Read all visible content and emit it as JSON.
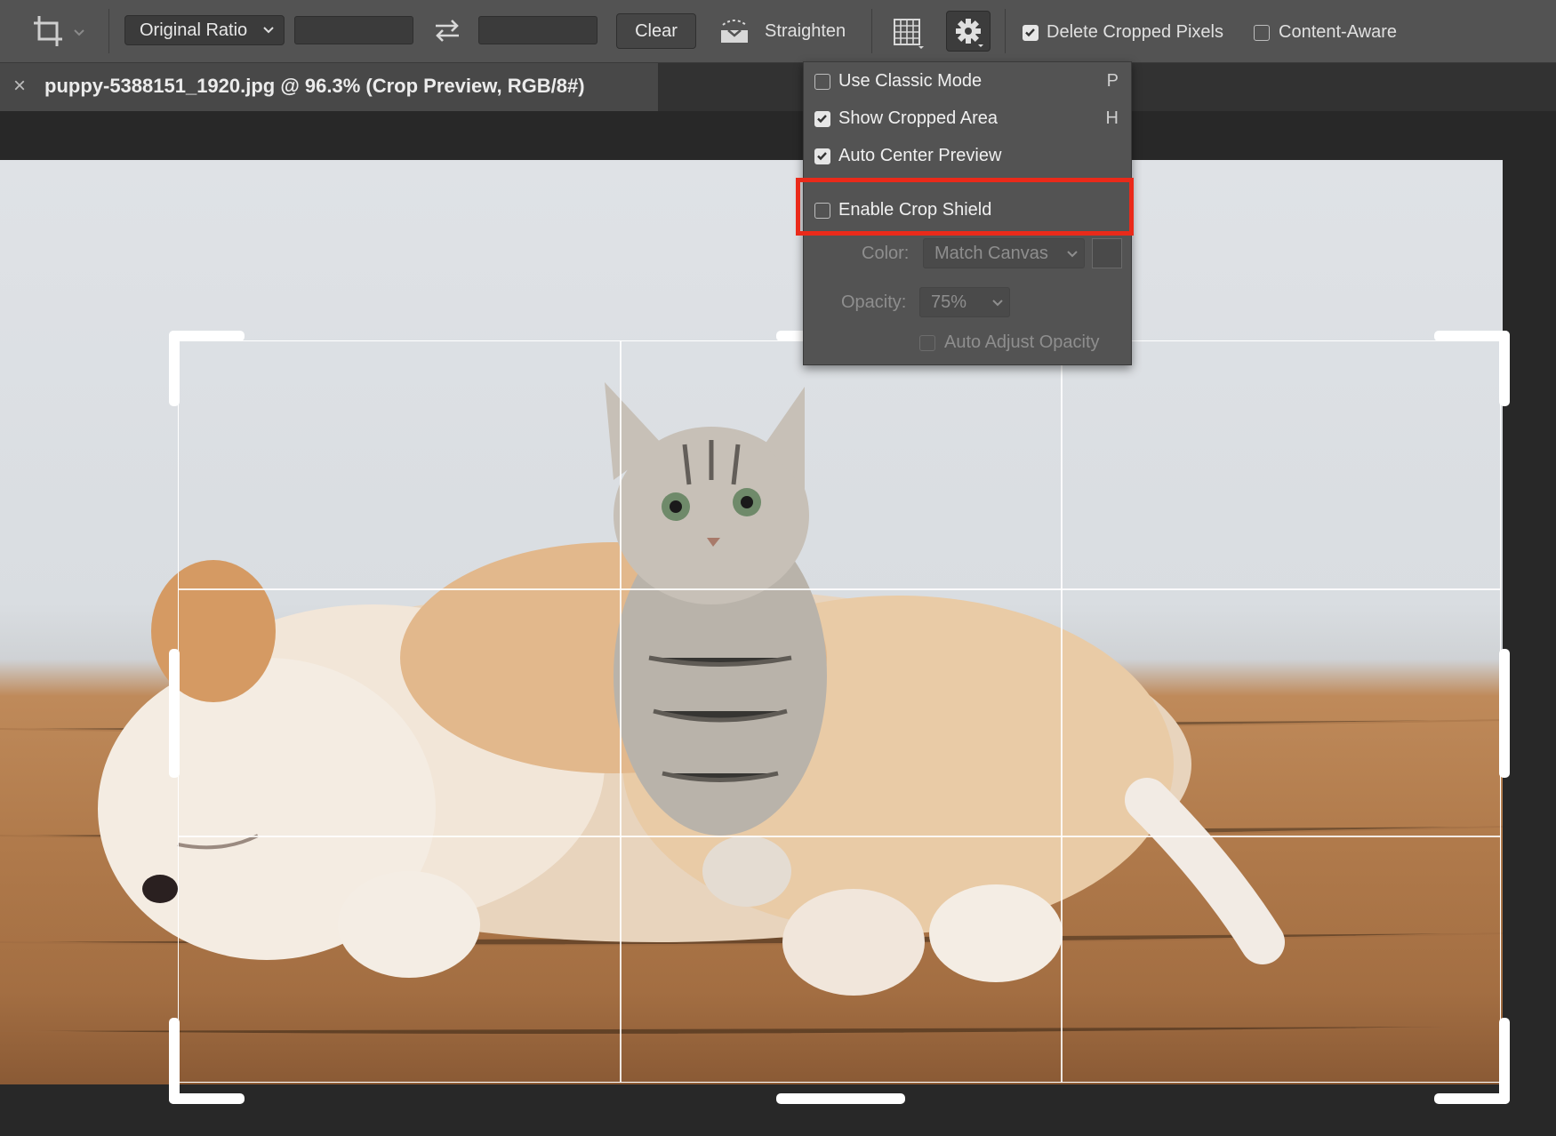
{
  "toolbar": {
    "ratio_select": "Original Ratio",
    "width_value": "",
    "height_value": "",
    "clear_label": "Clear",
    "straighten_label": "Straighten",
    "delete_cropped_pixels": {
      "label": "Delete Cropped Pixels",
      "checked": true
    },
    "content_aware": {
      "label": "Content-Aware",
      "checked": false
    }
  },
  "document_tab": {
    "title": "puppy-5388151_1920.jpg @ 96.3% (Crop Preview, RGB/8#)",
    "close_glyph": "×"
  },
  "settings_menu": {
    "items": [
      {
        "label": "Use Classic Mode",
        "shortcut": "P",
        "checked": false
      },
      {
        "label": "Show Cropped Area",
        "shortcut": "H",
        "checked": true
      },
      {
        "label": "Auto Center Preview",
        "shortcut": "",
        "checked": true
      },
      {
        "label": "Enable Crop Shield",
        "shortcut": "",
        "checked": false
      }
    ],
    "color_label": "Color:",
    "color_value": "Match Canvas",
    "opacity_label": "Opacity:",
    "opacity_value": "75%",
    "auto_adjust_opacity": {
      "label": "Auto Adjust Opacity",
      "checked": false
    }
  },
  "colors": {
    "highlight": "#ea2a1a",
    "toolbar_bg": "#535353",
    "canvas_bg": "#282828"
  }
}
